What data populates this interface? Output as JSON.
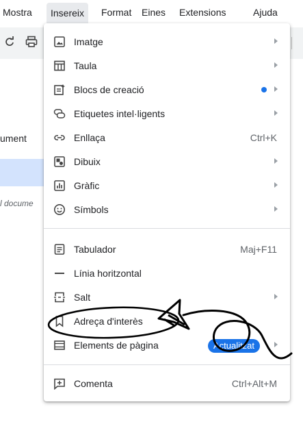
{
  "menubar": {
    "items": [
      "Mostra",
      "Insereix",
      "Format",
      "Eines",
      "Extensions",
      "Ajuda"
    ]
  },
  "background": {
    "doc_label": "ument",
    "italic_text": "l docume"
  },
  "menu": {
    "items": [
      {
        "label": "Imatge",
        "icon": "image-icon"
      },
      {
        "label": "Taula",
        "icon": "table-icon"
      },
      {
        "label": "Blocs de creació",
        "icon": "building-blocks-icon"
      },
      {
        "label": "Etiquetes intel·ligents",
        "icon": "smart-chips-icon"
      },
      {
        "label": "Enllaça",
        "icon": "link-icon",
        "shortcut": "Ctrl+K"
      },
      {
        "label": "Dibuix",
        "icon": "drawing-icon"
      },
      {
        "label": "Gràfic",
        "icon": "chart-icon"
      },
      {
        "label": "Símbols",
        "icon": "emoji-icon"
      },
      {
        "label": "Tabulador",
        "icon": "tab-icon",
        "shortcut": "Maj+F11"
      },
      {
        "label": "Línia horitzontal",
        "icon": "horizontal-line-icon"
      },
      {
        "label": "Salt",
        "icon": "break-icon"
      },
      {
        "label": "Adreça d'interès",
        "icon": "bookmark-icon"
      },
      {
        "label": "Elements de pàgina",
        "icon": "page-elements-icon",
        "badge": "Actualitzat"
      },
      {
        "label": "Comenta",
        "icon": "comment-icon",
        "shortcut": "Ctrl+Alt+M"
      }
    ]
  },
  "colors": {
    "accent": "#1a73e8",
    "highlight": "#d3e3fd",
    "annotation": "#000000"
  }
}
